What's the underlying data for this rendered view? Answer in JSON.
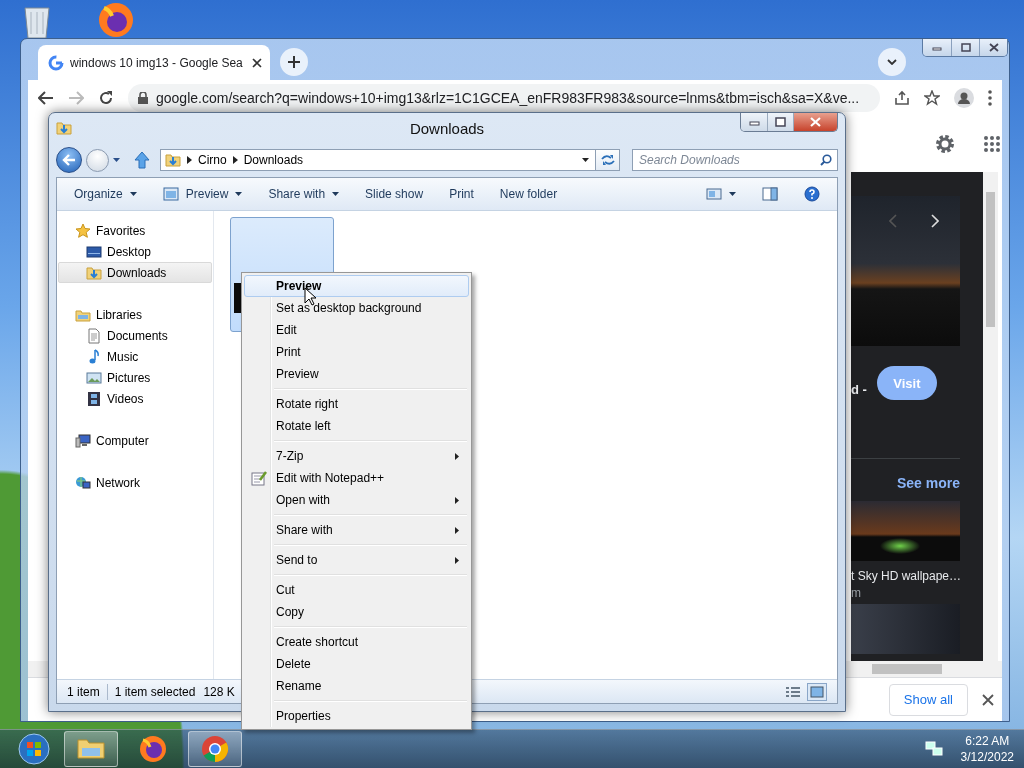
{
  "browser": {
    "tab": {
      "title": "windows 10 img13 - Google Sea",
      "selected": true
    },
    "address": "google.com/search?q=windows+10+img13&rlz=1C1GCEA_enFR983FR983&source=lnms&tbm=isch&sa=X&ve...",
    "result": {
      "title_fragment": "d -",
      "visit": "Visit",
      "see_more": "See more",
      "related": [
        {
          "caption": "t Sky HD wallpape…",
          "source": "m"
        }
      ]
    },
    "downloads_bar": {
      "show_all": "Show all"
    }
  },
  "explorer": {
    "title": "Downloads",
    "breadcrumb": [
      "Cirno",
      "Downloads"
    ],
    "search": {
      "placeholder": "Search Downloads"
    },
    "toolbar": [
      {
        "label": "Organize",
        "dropdown": true,
        "kind": "text"
      },
      {
        "label": "Preview",
        "dropdown": true,
        "kind": "preview"
      },
      {
        "label": "Share with",
        "dropdown": true,
        "kind": "text"
      },
      {
        "label": "Slide show",
        "dropdown": false,
        "kind": "text"
      },
      {
        "label": "Print",
        "dropdown": false,
        "kind": "text"
      },
      {
        "label": "New folder",
        "dropdown": false,
        "kind": "text"
      }
    ],
    "nav": [
      {
        "label": "Favorites",
        "kind": "star",
        "selected": false,
        "children": [
          {
            "label": "Desktop",
            "kind": "desktop",
            "selected": false
          },
          {
            "label": "Downloads",
            "kind": "downloads",
            "selected": true
          }
        ]
      },
      {
        "label": "Libraries",
        "kind": "library",
        "selected": false,
        "children": [
          {
            "label": "Documents",
            "kind": "document",
            "selected": false
          },
          {
            "label": "Music",
            "kind": "music",
            "selected": false
          },
          {
            "label": "Pictures",
            "kind": "picture",
            "selected": false
          },
          {
            "label": "Videos",
            "kind": "video",
            "selected": false
          }
        ]
      },
      {
        "label": "Computer",
        "kind": "computer",
        "selected": false
      },
      {
        "label": "Network",
        "kind": "network",
        "selected": false
      }
    ],
    "files": [
      {
        "selected": true
      }
    ],
    "status": {
      "item_count": "1 item",
      "selection": "1 item selected",
      "size": "128 K"
    }
  },
  "context_menu": {
    "groups": [
      {
        "items": [
          {
            "label": "Preview",
            "default": true,
            "selected": true,
            "submenu": false
          },
          {
            "label": "Set as desktop background",
            "default": false,
            "selected": false,
            "submenu": false
          },
          {
            "label": "Edit",
            "default": false,
            "selected": false,
            "submenu": false
          },
          {
            "label": "Print",
            "default": false,
            "selected": false,
            "submenu": false
          },
          {
            "label": "Preview",
            "default": false,
            "selected": false,
            "submenu": false
          }
        ]
      },
      {
        "items": [
          {
            "label": "Rotate right",
            "default": false,
            "selected": false,
            "submenu": false
          },
          {
            "label": "Rotate left",
            "default": false,
            "selected": false,
            "submenu": false
          }
        ]
      },
      {
        "items": [
          {
            "label": "7-Zip",
            "default": false,
            "selected": false,
            "submenu": true
          },
          {
            "label": "Edit with Notepad++",
            "default": false,
            "selected": false,
            "submenu": false,
            "kind": "notepad"
          },
          {
            "label": "Open with",
            "default": false,
            "selected": false,
            "submenu": true
          }
        ]
      },
      {
        "items": [
          {
            "label": "Share with",
            "default": false,
            "selected": false,
            "submenu": true
          }
        ]
      },
      {
        "items": [
          {
            "label": "Send to",
            "default": false,
            "selected": false,
            "submenu": true
          }
        ]
      },
      {
        "items": [
          {
            "label": "Cut",
            "default": false,
            "selected": false,
            "submenu": false
          },
          {
            "label": "Copy",
            "default": false,
            "selected": false,
            "submenu": false
          }
        ]
      },
      {
        "items": [
          {
            "label": "Create shortcut",
            "default": false,
            "selected": false,
            "submenu": false
          },
          {
            "label": "Delete",
            "default": false,
            "selected": false,
            "submenu": false
          },
          {
            "label": "Rename",
            "default": false,
            "selected": false,
            "submenu": false
          }
        ]
      },
      {
        "items": [
          {
            "label": "Properties",
            "default": false,
            "selected": false,
            "submenu": false
          }
        ]
      }
    ]
  },
  "taskbar": {
    "apps": [
      {
        "kind": "explorer",
        "open": true
      },
      {
        "kind": "firefox",
        "open": false
      },
      {
        "kind": "chrome",
        "open": true
      }
    ],
    "time": "6:22 AM",
    "date": "3/12/2022"
  }
}
